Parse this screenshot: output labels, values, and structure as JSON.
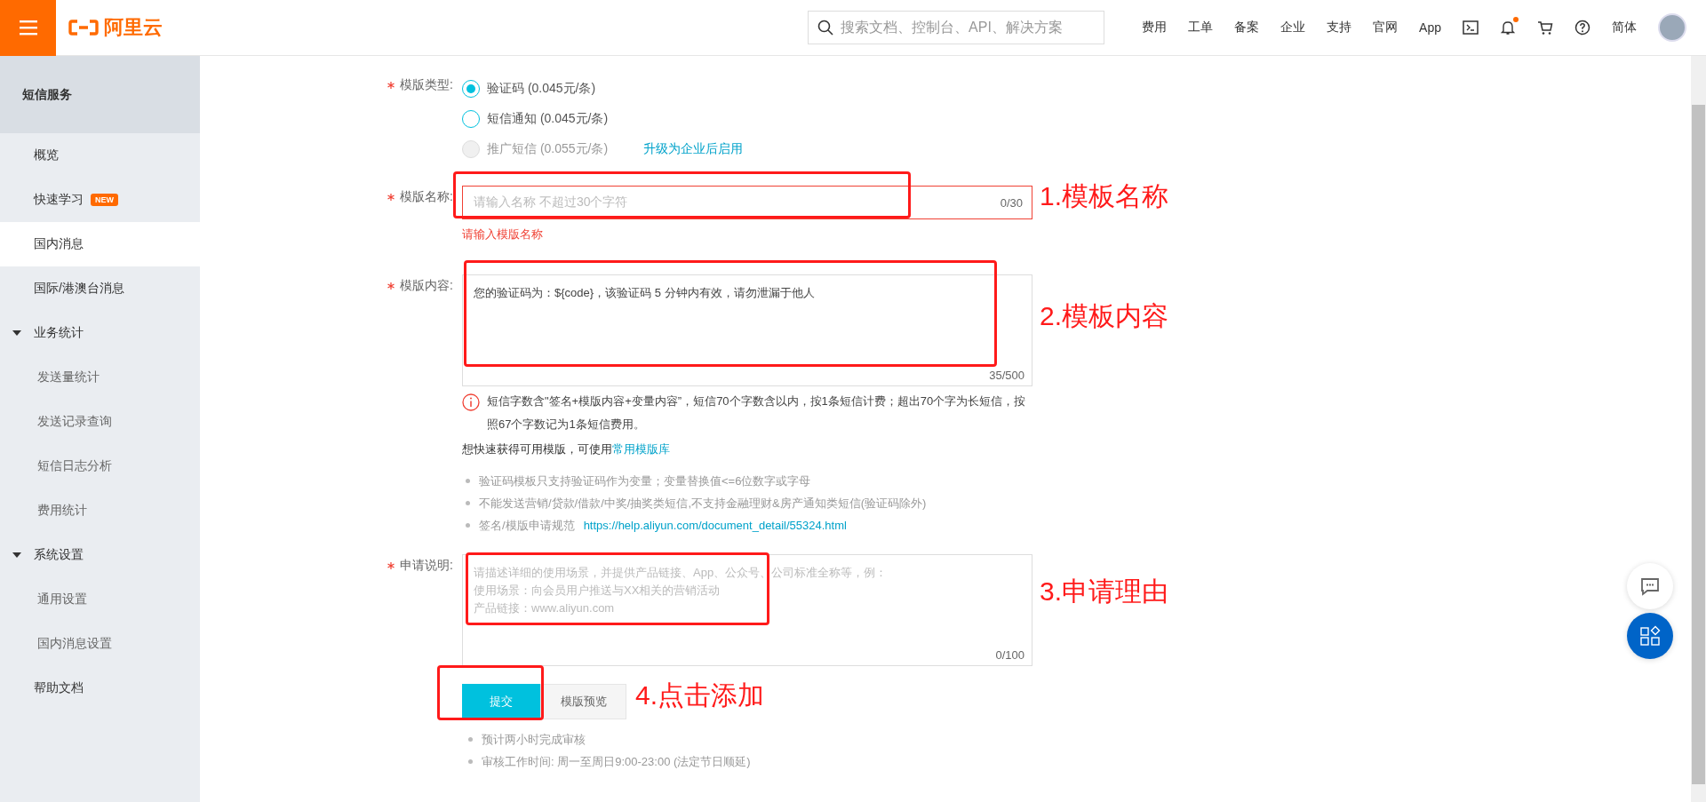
{
  "header": {
    "logo_text": "阿里云",
    "search": {
      "placeholder": "搜索文档、控制台、API、解决方案"
    },
    "nav": [
      "费用",
      "工单",
      "备案",
      "企业",
      "支持",
      "官网",
      "App"
    ],
    "notification_dot": true,
    "language": "简体"
  },
  "sidebar": {
    "title": "短信服务",
    "items": [
      {
        "label": "概览",
        "selected": false
      },
      {
        "label": "快速学习",
        "selected": false,
        "badge": "NEW"
      },
      {
        "label": "国内消息",
        "selected": true
      },
      {
        "label": "国际/港澳台消息",
        "selected": false
      },
      {
        "label": "业务统计",
        "selected": false,
        "expanded": true,
        "children": [
          {
            "label": "发送量统计",
            "selected": false
          },
          {
            "label": "发送记录查询",
            "selected": false
          },
          {
            "label": "短信日志分析",
            "selected": false
          },
          {
            "label": "费用统计",
            "selected": false
          }
        ]
      },
      {
        "label": "系统设置",
        "selected": false,
        "expanded": true,
        "children": [
          {
            "label": "通用设置",
            "selected": false
          },
          {
            "label": "国内消息设置",
            "selected": false
          }
        ]
      },
      {
        "label": "帮助文档",
        "selected": false
      }
    ]
  },
  "form": {
    "type_field": {
      "label": "模版类型:",
      "options": [
        {
          "label": "验证码 (0.045元/条)",
          "selected": true,
          "disabled": false
        },
        {
          "label": "短信通知 (0.045元/条)",
          "selected": false,
          "disabled": false
        },
        {
          "label": "推广短信 (0.055元/条)",
          "selected": false,
          "disabled": true,
          "link": "升级为企业后启用"
        }
      ]
    },
    "name_field": {
      "label": "模版名称:",
      "placeholder": "请输入名称 不超过30个字符",
      "counter": "0/30",
      "error": "请输入模版名称"
    },
    "content_field": {
      "label": "模版内容:",
      "value": "您的验证码为：${code}，该验证码 5 分钟内有效，请勿泄漏于他人",
      "counter": "35/500"
    },
    "info": "短信字数含\"签名+模版内容+变量内容”，短信70个字数含以内，按1条短信计费；超出70个字为长短信，按照67个字数记为1条短信费用。",
    "quick_text": "想快速获得可用模版，可使用",
    "quick_link": "常用模版库",
    "rules": [
      {
        "text": "验证码模板只支持验证码作为变量；变量替换值<=6位数字或字母"
      },
      {
        "text": "不能发送营销/贷款/借款/中奖/抽奖类短信,不支持金融理财&房产通知类短信(验证码除外)"
      },
      {
        "text": "签名/模版申请规范",
        "link": "https://help.aliyun.com/document_detail/55324.html"
      }
    ],
    "reason_field": {
      "label": "申请说明:",
      "placeholder_lines": [
        "请描述详细的使用场景，并提供产品链接、App、公众号、公司标准全称等，例：",
        "使用场景：向会员用户推送与XX相关的营销活动",
        "产品链接：www.aliyun.com"
      ],
      "counter": "0/100"
    },
    "buttons": [
      {
        "label": "提交",
        "kind": "primary"
      },
      {
        "label": "模版预览",
        "kind": "secondary"
      }
    ],
    "notes": [
      "预计两小时完成审核",
      "审核工作时间: 周一至周日9:00-23:00  (法定节日顺延)"
    ]
  },
  "annotations": [
    "1.模板名称",
    "2.模板内容",
    "3.申请理由",
    "4.点击添加"
  ]
}
